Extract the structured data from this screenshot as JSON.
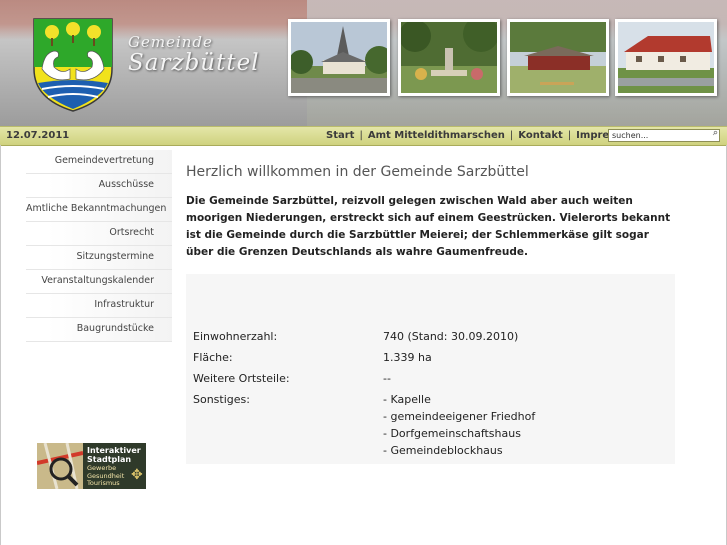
{
  "header": {
    "brand_small": "Gemeinde",
    "brand_big": "Sarzbüttel",
    "crest_icon": "coat-of-arms-icon",
    "photos": [
      "church-photo",
      "memorial-photo",
      "barn-photo",
      "farmhouse-photo"
    ]
  },
  "nav": {
    "date": "12.07.2011",
    "links": [
      {
        "label": "Start"
      },
      {
        "label": "Amt Mitteldithmarschen"
      },
      {
        "label": "Kontakt"
      },
      {
        "label": "Impressum"
      }
    ],
    "separator": "|",
    "search_value": "suchen...",
    "search_button_icon": "search-icon"
  },
  "sidebar": {
    "items": [
      {
        "label": "Gemeindevertretung"
      },
      {
        "label": "Ausschüsse"
      },
      {
        "label": "Amtliche Bekanntmachungen"
      },
      {
        "label": "Ortsrecht"
      },
      {
        "label": "Sitzungstermine"
      },
      {
        "label": "Veranstaltungskalender"
      },
      {
        "label": "Infrastruktur"
      },
      {
        "label": "Baugrundstücke"
      }
    ],
    "stadtplan": {
      "line1": "Interaktiver",
      "line2": "Stadtplan",
      "line3": "Gewerbe",
      "line4": "Gesundheit",
      "line5": "Tourismus"
    }
  },
  "main": {
    "title": "Herzlich willkommen in der Gemeinde Sarzbüttel",
    "intro": "Die Gemeinde Sarzbüttel, reizvoll gelegen zwischen Wald aber auch weiten moorigen Niederungen, erstreckt sich auf einem Geestrücken. Vielerorts bekannt ist die Gemeinde durch die Sarzbüttler Meierei; der Schlemmerkäse gilt sogar über die Grenzen Deutschlands als wahre Gaumenfreude.",
    "facts": [
      {
        "key": "Einwohnerzahl:",
        "value": "740 (Stand: 30.09.2010)"
      },
      {
        "key": "Fläche:",
        "value": " 1.339 ha"
      },
      {
        "key": "Weitere Ortsteile:",
        "value": "--"
      }
    ],
    "sonstiges_label": "Sonstiges:",
    "sonstiges": [
      "- Kapelle",
      "- gemeindeeigener Friedhof",
      "- Dorfgemeinschaftshaus",
      "- Gemeindeblockhaus"
    ]
  },
  "colors": {
    "nav_bar": "#d8db8f",
    "crest_green": "#2ea82a",
    "crest_blue": "#1d5fb0"
  }
}
